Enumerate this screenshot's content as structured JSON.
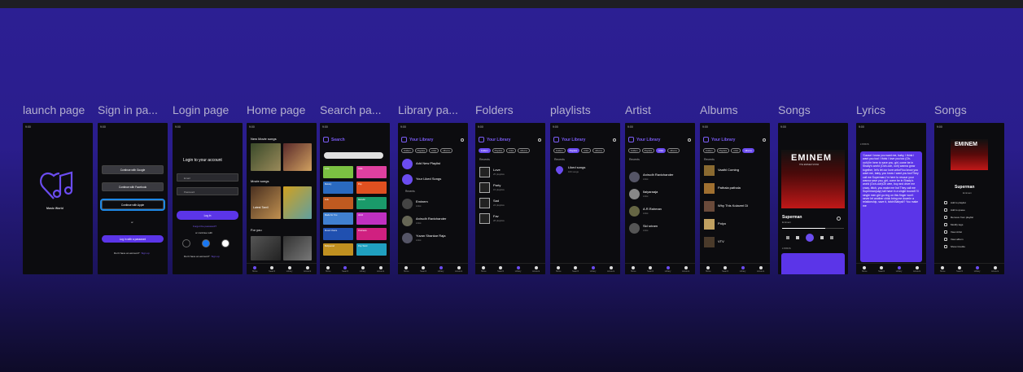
{
  "frames": [
    {
      "label": "launch page"
    },
    {
      "label": "Sign in pa..."
    },
    {
      "label": "Login page"
    },
    {
      "label": "Home page"
    },
    {
      "label": "Search pa..."
    },
    {
      "label": "Library pa..."
    },
    {
      "label": "Folders"
    },
    {
      "label": "playlists"
    },
    {
      "label": "Artist"
    },
    {
      "label": "Albums"
    },
    {
      "label": "Songs"
    },
    {
      "label": "Lyrics"
    },
    {
      "label": "Songs"
    }
  ],
  "status_time": "9:00",
  "nav": [
    "Home",
    "Search",
    "Library",
    "Account"
  ],
  "launch": {
    "app_name": "Music World"
  },
  "signin": {
    "google": "Continue with Google",
    "facebook": "Continue with Facebook",
    "apple": "Continue with Apple",
    "or": "or",
    "password": "Log in with a password",
    "no_account": "Don't have an account?",
    "sign_up": "Sign up"
  },
  "login": {
    "title": "Login to your account",
    "email_placeholder": "Email",
    "password_placeholder": "Password",
    "login_btn": "Log in",
    "forgot": "Forgot the password?",
    "continue_with": "or continue with",
    "no_account": "Don't have an account?",
    "sign_up": "Sign up"
  },
  "home": {
    "new_movie": "New Movie songs",
    "movie": "Movie songs",
    "latest": "Latest Tamil",
    "for_you": "For you"
  },
  "search": {
    "title": "Search",
    "tiles": [
      "Love",
      "Indie",
      "Melody",
      "Pop",
      "Folk",
      "Melodic",
      "Made for You",
      "Hindi",
      "Music Charts",
      "Podcasts",
      "Bollywood",
      "Pop Tamil"
    ]
  },
  "library": {
    "title": "Your Library",
    "chips": [
      "Folders",
      "Playlists",
      "Artist",
      "Albums"
    ],
    "add_playlist": "Add New Playlist",
    "liked": "Your Liked Songs",
    "recents": "Recents",
    "artists": [
      {
        "name": "Eminem",
        "sub": "Artist"
      },
      {
        "name": "Anirudh Ravichander",
        "sub": "Artist"
      },
      {
        "name": "Yuvan Shankar Raja",
        "sub": "Artist"
      }
    ]
  },
  "folders": {
    "recents": "Recents",
    "items": [
      {
        "name": "Love",
        "sub": "25 playlists"
      },
      {
        "name": "Party",
        "sub": "15 playlists"
      },
      {
        "name": "Sad",
        "sub": "24 playlists"
      },
      {
        "name": "Fav",
        "sub": "28 playlists"
      }
    ]
  },
  "playlists": {
    "recents": "Recents",
    "liked": "Liked songs",
    "liked_sub": "100 songs"
  },
  "artist": {
    "recents": "Recents",
    "items": [
      {
        "name": "Anirudh Ravichander",
        "sub": "Artist"
      },
      {
        "name": "Ilaiyaraaja",
        "sub": "Artist"
      },
      {
        "name": "A.R.Rahman",
        "sub": "Artist"
      },
      {
        "name": "Sid sriram",
        "sub": "Artist"
      }
    ]
  },
  "albums": {
    "recents": "Recents",
    "items": [
      "Vaathi Coming",
      "Pathala pathala",
      "Why This Kolaveri Di",
      "Polyo",
      "VTV"
    ]
  },
  "songs": {
    "album_art_text": "EMINEM",
    "album_sub": "THE EMINEM SHOW",
    "song": "Superman",
    "artist": "Eminem",
    "lyrics_label": "LYRICS"
  },
  "lyrics": {
    "label": "LYRICS",
    "text": "'Cause I know you want me, baby, I think I want you too! I think I love you too (Oh-ooh)I'm here to save you, girl, come be in Shady's world (Ooh-ooh, ooh) wanna grow together, let's let our love unfurlYou know you want me, baby, you know I want you too!They call me Superman,I'm here to rescue your wanna save you, girl, come be in Shady's world (Ooh-ooh)Oh wee, boy and drive me crazy, bitch, you make me hot They call me Superman(cap) tall have in a single bound! I'll single men girl go ring on this finger won't never let another chick bring me downIn a relationship, save it, b#ch!Babysit? You make me"
  },
  "song_menu": {
    "song": "Superman",
    "artist": "Eminem",
    "items": [
      "Add to playlist",
      "Add to queue",
      "Remove from playlist",
      "Modify tags",
      "View Artist",
      "View album",
      "Show Credits"
    ]
  },
  "colors": {
    "accent": "#6b4cf0",
    "bg": "#2a1d8c",
    "phone": "#0c0c0f",
    "highlight": "#1e88e5"
  }
}
